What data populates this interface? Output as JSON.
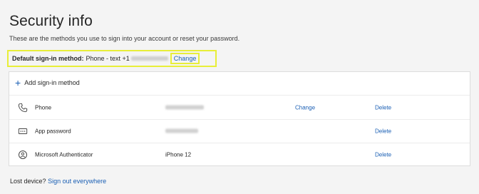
{
  "page": {
    "title": "Security info",
    "subtitle": "These are the methods you use to sign into your account or reset your password."
  },
  "default_method": {
    "label": "Default sign-in method:",
    "value": "Phone - text +1",
    "change": "Change",
    "highlight_color": "#e8ee38"
  },
  "methods_card": {
    "add_label": "Add sign-in method",
    "rows": [
      {
        "icon": "phone-icon",
        "name": "Phone",
        "detail_redacted": true,
        "change": "Change",
        "delete": "Delete"
      },
      {
        "icon": "password-icon",
        "name": "App password",
        "detail_redacted": true,
        "delete": "Delete"
      },
      {
        "icon": "authenticator-icon",
        "name": "Microsoft Authenticator",
        "detail": "iPhone 12",
        "delete": "Delete"
      }
    ]
  },
  "footer": {
    "lost_device": "Lost device?",
    "sign_out": "Sign out everywhere"
  },
  "colors": {
    "link": "#1a5fb4",
    "background": "#f4f4f4",
    "card": "#ffffff"
  }
}
